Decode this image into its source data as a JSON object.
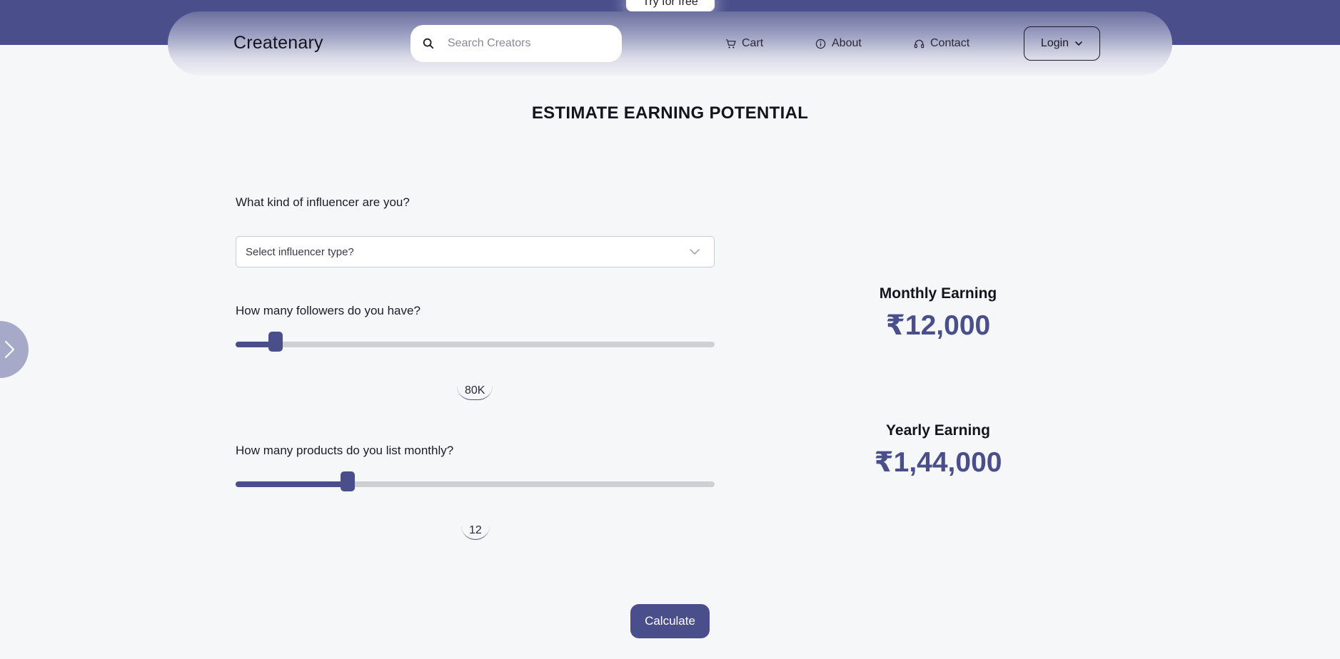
{
  "banner": {
    "cta_label": "Try for free"
  },
  "nav": {
    "brand": "Createnary",
    "search_placeholder": "Search Creators",
    "links": [
      {
        "label": "Cart",
        "icon": "cart-icon"
      },
      {
        "label": "About",
        "icon": "info-icon"
      },
      {
        "label": "Contact",
        "icon": "headset-icon"
      }
    ],
    "login_label": "Login"
  },
  "main": {
    "title": "ESTIMATE EARNING POTENTIAL",
    "influencer_question": "What kind of influencer are you?",
    "influencer_select_placeholder": "Select influencer type?",
    "followers_question": "How many followers do you have?",
    "followers_value": "80K",
    "followers_slider_fraction": 0.083,
    "products_question": "How many products do you list monthly?",
    "products_value": "12",
    "products_slider_fraction": 0.234,
    "calculate_label": "Calculate"
  },
  "results": {
    "monthly_label": "Monthly Earning",
    "monthly_value": "₹12,000",
    "yearly_label": "Yearly Earning",
    "yearly_value": "₹1,44,000"
  },
  "colors": {
    "accent": "#4a4f8c",
    "track": "#cfd0d3",
    "background": "#f6f7f9",
    "side_toggle": "#a7a9c9"
  }
}
